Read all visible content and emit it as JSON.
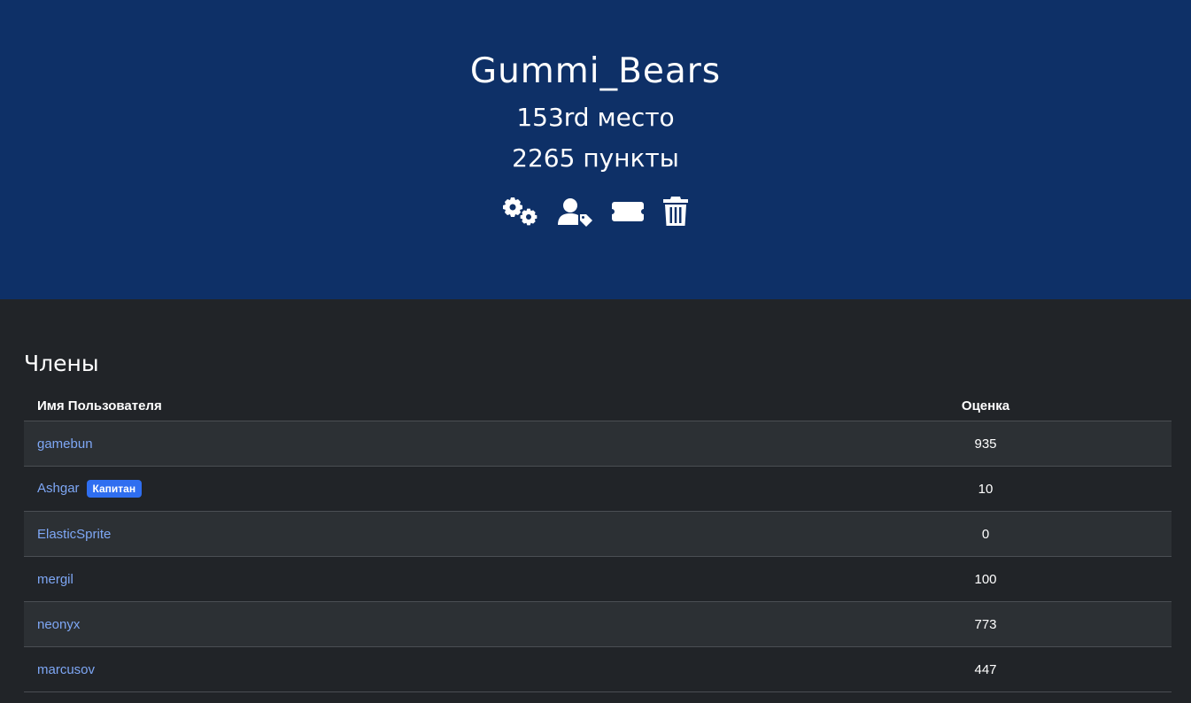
{
  "team": {
    "name": "Gummi_Bears",
    "place": "153rd место",
    "points": "2265 пункты"
  },
  "actions": [
    {
      "icon": "gears-icon"
    },
    {
      "icon": "user-tag-icon"
    },
    {
      "icon": "ticket-icon"
    },
    {
      "icon": "trash-icon"
    }
  ],
  "members": {
    "title": "Члены",
    "columns": {
      "username": "Имя Пользователя",
      "score": "Оценка"
    },
    "rows": [
      {
        "name": "gamebun",
        "score": "935"
      },
      {
        "name": "Ashgar",
        "score": "10",
        "badge": "Капитан"
      },
      {
        "name": "ElasticSprite",
        "score": "0"
      },
      {
        "name": "mergil",
        "score": "100"
      },
      {
        "name": "neonyx",
        "score": "773"
      },
      {
        "name": "marcusov",
        "score": "447"
      }
    ]
  },
  "colors": {
    "hero_bg": "#0e3067",
    "page_bg": "#212428",
    "link": "#7ea7f5",
    "badge": "#2f6ef0"
  }
}
